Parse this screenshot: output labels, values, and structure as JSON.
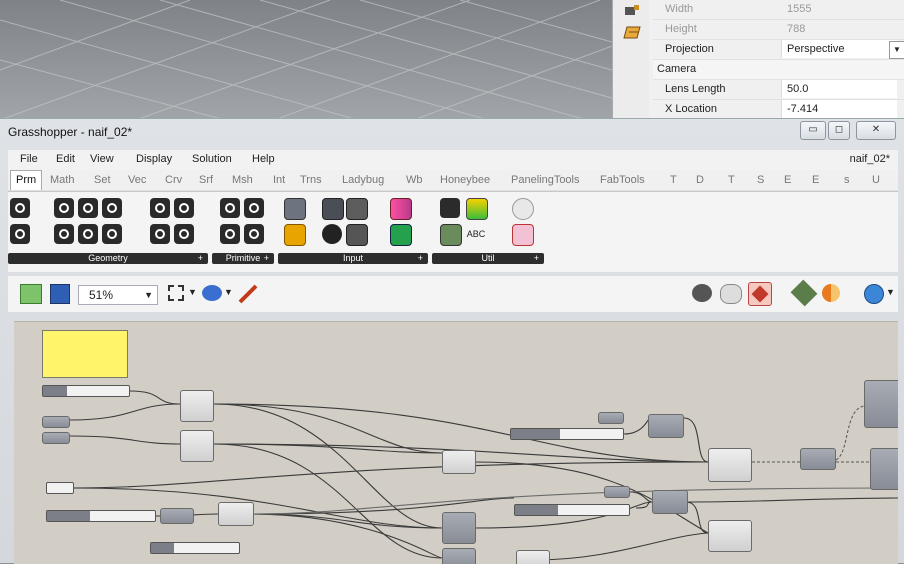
{
  "rhino": {
    "properties": [
      {
        "key": "Width",
        "value": "1555",
        "dim": true
      },
      {
        "key": "Height",
        "value": "788",
        "dim": true
      },
      {
        "key": "Projection",
        "value": "Perspective",
        "dim": false,
        "dropdown": true
      },
      {
        "key": "Camera",
        "value": "",
        "section": true
      },
      {
        "key": "Lens Length",
        "value": "50.0",
        "dim": false
      },
      {
        "key": "X Location",
        "value": "-7.414",
        "dim": false
      }
    ]
  },
  "window": {
    "title": "Grasshopper - naif_02*",
    "doc_name": "naif_02*",
    "controls": [
      "minimize-icon",
      "maximize-icon",
      "close-icon"
    ]
  },
  "menu": [
    "File",
    "Edit",
    "View",
    "Display",
    "Solution",
    "Help"
  ],
  "tabs": [
    "Prm",
    "Math",
    "Set",
    "Vec",
    "Crv",
    "Srf",
    "Msh",
    "Int",
    "Trns",
    "Ladybug",
    "Wb",
    "Honeybee",
    "PanelingTools",
    "FabTools",
    "T",
    "D",
    "T",
    "S",
    "E",
    "E",
    "s",
    "U"
  ],
  "active_tab": "Prm",
  "ribbon_panels": [
    {
      "label": "Geometry"
    },
    {
      "label": "Primitive"
    },
    {
      "label": "Input"
    },
    {
      "label": "Util"
    }
  ],
  "canvas_toolbar": {
    "zoom": "51%"
  },
  "colors": {
    "canvas": "#d2cec6",
    "panel_yellow": "#fff46a",
    "wire": "#3a3a3a",
    "accent": "#c0392b"
  }
}
